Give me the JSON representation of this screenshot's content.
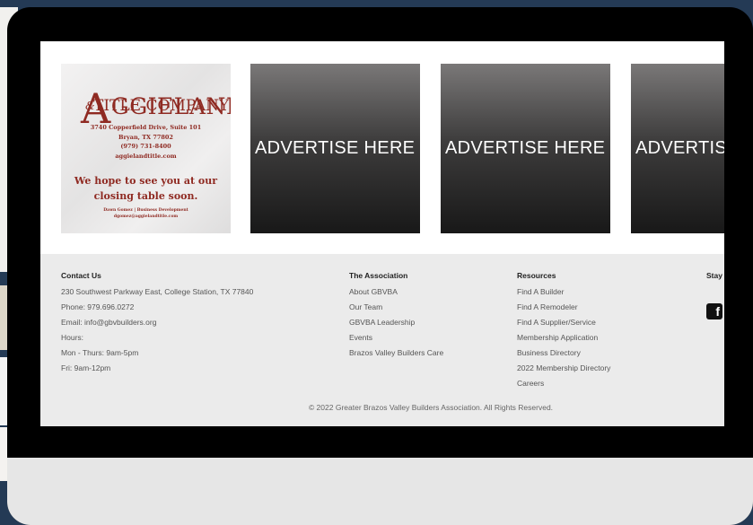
{
  "ads": {
    "aggieland": {
      "logo_line1_big": "A",
      "logo_line1": "GGIELAND",
      "logo_amp": "&",
      "logo_line2": "TITLE COMPANY",
      "address1": "3740 Copperfield Drive, Suite 101",
      "address2": "Bryan, TX 77802",
      "phone": "(979) 731-8400",
      "website": "aggielandtitle.com",
      "tagline1": "We hope to see you at our",
      "tagline2": "closing table soon.",
      "contact1": "Dawn Gomez | Business Development",
      "contact2": "dgomez@aggielandtitle.com"
    },
    "advertise": [
      "ADVERTISE HERE",
      "ADVERTISE HERE",
      "ADVERTIS"
    ]
  },
  "footer": {
    "contact": {
      "heading": "Contact Us",
      "lines": [
        "230 Southwest Parkway East, College Station, TX 77840",
        "Phone: 979.696.0272",
        "Email: info@gbvbuilders.org",
        "Hours:",
        "Mon - Thurs: 9am-5pm",
        "Fri: 9am-12pm"
      ]
    },
    "association": {
      "heading": "The Association",
      "links": [
        "About GBVBA",
        "Our Team",
        "GBVBA Leadership",
        "Events",
        "Brazos Valley Builders Care"
      ]
    },
    "resources": {
      "heading": "Resources",
      "links": [
        "Find A Builder",
        "Find A Remodeler",
        "Find A Supplier/Service",
        "Membership Application",
        "Business Directory",
        "2022 Membership Directory",
        "Careers"
      ]
    },
    "stay": {
      "heading": "Stay",
      "facebook_icon_glyph": "f"
    },
    "copyright": "© 2022 Greater Brazos Valley Builders Association. All Rights Reserved."
  }
}
